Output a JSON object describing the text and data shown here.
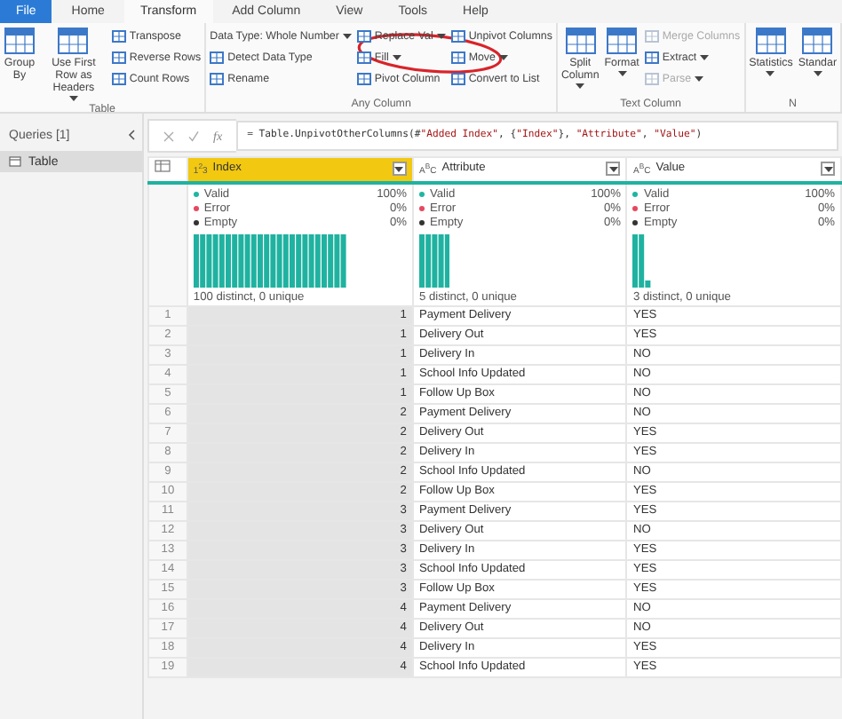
{
  "menu_tabs": [
    {
      "label": "File",
      "selected": false,
      "kind": "file"
    },
    {
      "label": "Home",
      "selected": false,
      "kind": "tab"
    },
    {
      "label": "Transform",
      "selected": true,
      "kind": "tab"
    },
    {
      "label": "Add Column",
      "selected": false,
      "kind": "tab"
    },
    {
      "label": "View",
      "selected": false,
      "kind": "tab"
    },
    {
      "label": "Tools",
      "selected": false,
      "kind": "tab"
    },
    {
      "label": "Help",
      "selected": false,
      "kind": "tab"
    }
  ],
  "ribbon": {
    "groups": [
      {
        "label": "Table",
        "items": [
          {
            "kind": "large",
            "label": "Group By",
            "menu": false,
            "disabled": false
          },
          {
            "kind": "large",
            "label": "Use First Row as Headers",
            "menu": true,
            "disabled": false
          },
          {
            "kind": "small",
            "label": "Transpose",
            "menu": false,
            "disabled": false
          },
          {
            "kind": "small",
            "label": "Reverse Rows",
            "menu": false,
            "disabled": false
          },
          {
            "kind": "small",
            "label": "Count Rows",
            "menu": false,
            "disabled": false
          }
        ]
      },
      {
        "label": "Any Column",
        "items": [
          {
            "kind": "small",
            "label": "Data Type: Whole Number",
            "menu": true,
            "disabled": false,
            "plain": true
          },
          {
            "kind": "small",
            "label": "Detect Data Type",
            "menu": false,
            "disabled": false
          },
          {
            "kind": "small",
            "label": "Rename",
            "menu": false,
            "disabled": false
          },
          {
            "kind": "small",
            "label": "Replace Val",
            "menu": true,
            "disabled": false
          },
          {
            "kind": "small",
            "label": "Fill",
            "menu": true,
            "disabled": false
          },
          {
            "kind": "small",
            "label": "Pivot Column",
            "menu": false,
            "disabled": false
          },
          {
            "kind": "small",
            "label": "Unpivot Columns",
            "menu": false,
            "disabled": false
          },
          {
            "kind": "small",
            "label": "Move",
            "menu": true,
            "disabled": false
          },
          {
            "kind": "small",
            "label": "Convert to List",
            "menu": false,
            "disabled": false
          }
        ]
      },
      {
        "label": "Text Column",
        "items": [
          {
            "kind": "large",
            "label": "Split Column",
            "menu": true,
            "disabled": false
          },
          {
            "kind": "large",
            "label": "Format",
            "menu": true,
            "disabled": false
          },
          {
            "kind": "small",
            "label": "Merge Columns",
            "menu": false,
            "disabled": true
          },
          {
            "kind": "small",
            "label": "Extract",
            "menu": true,
            "disabled": false
          },
          {
            "kind": "small",
            "label": "Parse",
            "menu": true,
            "disabled": true
          }
        ]
      },
      {
        "label": "N",
        "items": [
          {
            "kind": "large",
            "label": "Statistics",
            "menu": true,
            "disabled": false
          },
          {
            "kind": "large",
            "label": "Standar",
            "menu": true,
            "disabled": false
          }
        ]
      }
    ]
  },
  "queries": {
    "title": "Queries [1]",
    "items": [
      {
        "label": "Table",
        "selected": true
      }
    ]
  },
  "formula_bar": {
    "fx_label": "fx",
    "formula": "= Table.UnpivotOtherColumns(#\"Added Index\", {\"Index\"}, \"Attribute\", \"Value\")"
  },
  "table": {
    "columns": [
      {
        "name": "Index",
        "type_icon": "1$^{2}$3",
        "selected": true,
        "stats": [
          {
            "label": "Valid",
            "value": "100%",
            "color": "#1fb5a3"
          },
          {
            "label": "Error",
            "value": "0%",
            "color": "#e8475f"
          },
          {
            "label": "Empty",
            "value": "0%",
            "color": "#333333"
          }
        ],
        "distinct": "100 distinct, 0 unique"
      },
      {
        "name": "Attribute",
        "type_icon": "A$^{B}$C",
        "selected": false,
        "stats": [
          {
            "label": "Valid",
            "value": "100%",
            "color": "#1fb5a3"
          },
          {
            "label": "Error",
            "value": "0%",
            "color": "#e8475f"
          },
          {
            "label": "Empty",
            "value": "0%",
            "color": "#333333"
          }
        ],
        "distinct": "5 distinct, 0 unique"
      },
      {
        "name": "Value",
        "type_icon": "A$^{B}$C",
        "selected": false,
        "stats": [
          {
            "label": "Valid",
            "value": "100%",
            "color": "#1fb5a3"
          },
          {
            "label": "Error",
            "value": "0%",
            "color": "#e8475f"
          },
          {
            "label": "Empty",
            "value": "0%",
            "color": "#333333"
          }
        ],
        "distinct": "3 distinct, 0 unique"
      }
    ],
    "rows": [
      {
        "num": "1",
        "cells": [
          "1",
          "Payment Delivery",
          "YES"
        ]
      },
      {
        "num": "2",
        "cells": [
          "1",
          "Delivery Out",
          "YES"
        ]
      },
      {
        "num": "3",
        "cells": [
          "1",
          "Delivery In",
          "NO"
        ]
      },
      {
        "num": "4",
        "cells": [
          "1",
          "School Info Updated",
          "NO"
        ]
      },
      {
        "num": "5",
        "cells": [
          "1",
          "Follow Up Box",
          "NO"
        ]
      },
      {
        "num": "6",
        "cells": [
          "2",
          "Payment Delivery",
          "NO"
        ]
      },
      {
        "num": "7",
        "cells": [
          "2",
          "Delivery Out",
          "YES"
        ]
      },
      {
        "num": "8",
        "cells": [
          "2",
          "Delivery In",
          "YES"
        ]
      },
      {
        "num": "9",
        "cells": [
          "2",
          "School Info Updated",
          "NO"
        ]
      },
      {
        "num": "10",
        "cells": [
          "2",
          "Follow Up Box",
          "YES"
        ]
      },
      {
        "num": "11",
        "cells": [
          "3",
          "Payment Delivery",
          "YES"
        ]
      },
      {
        "num": "12",
        "cells": [
          "3",
          "Delivery Out",
          "NO"
        ]
      },
      {
        "num": "13",
        "cells": [
          "3",
          "Delivery In",
          "YES"
        ]
      },
      {
        "num": "14",
        "cells": [
          "3",
          "School Info Updated",
          "YES"
        ]
      },
      {
        "num": "15",
        "cells": [
          "3",
          "Follow Up Box",
          "YES"
        ]
      },
      {
        "num": "16",
        "cells": [
          "4",
          "Payment Delivery",
          "NO"
        ]
      },
      {
        "num": "17",
        "cells": [
          "4",
          "Delivery Out",
          "NO"
        ]
      },
      {
        "num": "18",
        "cells": [
          "4",
          "Delivery In",
          "YES"
        ]
      },
      {
        "num": "19",
        "cells": [
          "4",
          "School Info Updated",
          "YES"
        ]
      }
    ]
  }
}
